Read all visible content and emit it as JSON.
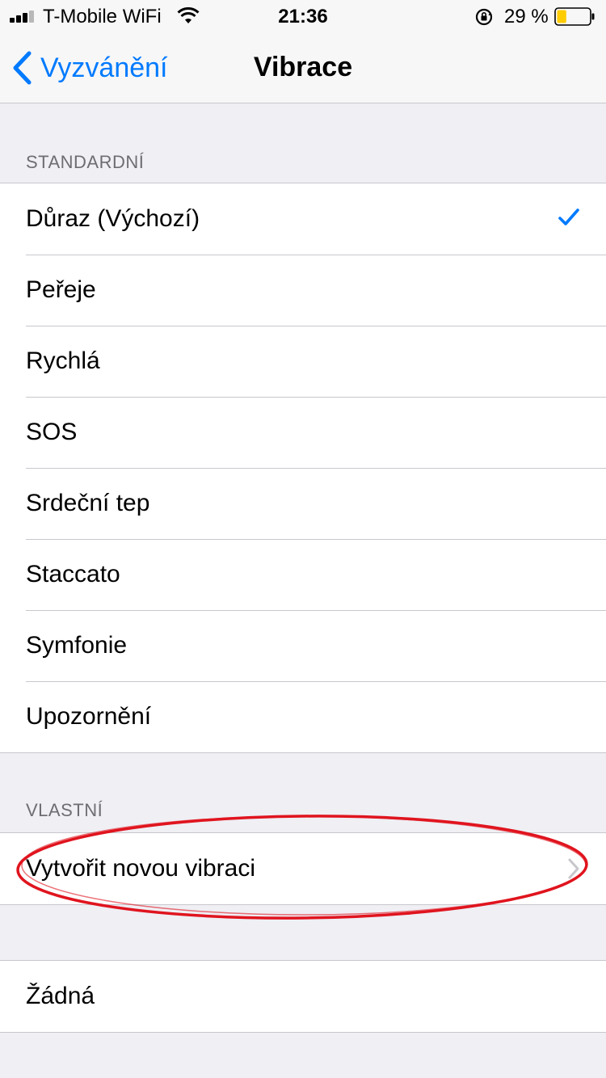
{
  "status_bar": {
    "carrier": "T-Mobile WiFi",
    "time": "21:36",
    "battery_percent": "29 %",
    "battery_level": 0.29,
    "icons": [
      "signal-icon",
      "wifi-icon",
      "orientation-lock-icon",
      "battery-icon"
    ]
  },
  "nav": {
    "back_label": "Vyzvánění",
    "title": "Vibrace"
  },
  "sections": {
    "standard": {
      "header": "STANDARDNÍ",
      "items": [
        "Důraz (Výchozí)",
        "Peřeje",
        "Rychlá",
        "SOS",
        "Srdeční tep",
        "Staccato",
        "Symfonie",
        "Upozornění"
      ],
      "selected_index": 0
    },
    "custom": {
      "header": "VLASTNÍ",
      "items": [
        "Vytvořit novou vibraci"
      ]
    },
    "none": {
      "items": [
        "Žádná"
      ]
    }
  },
  "colors": {
    "accent": "#007aff",
    "annotation": "#e0141e",
    "battery_fill": "#ffcc00"
  }
}
